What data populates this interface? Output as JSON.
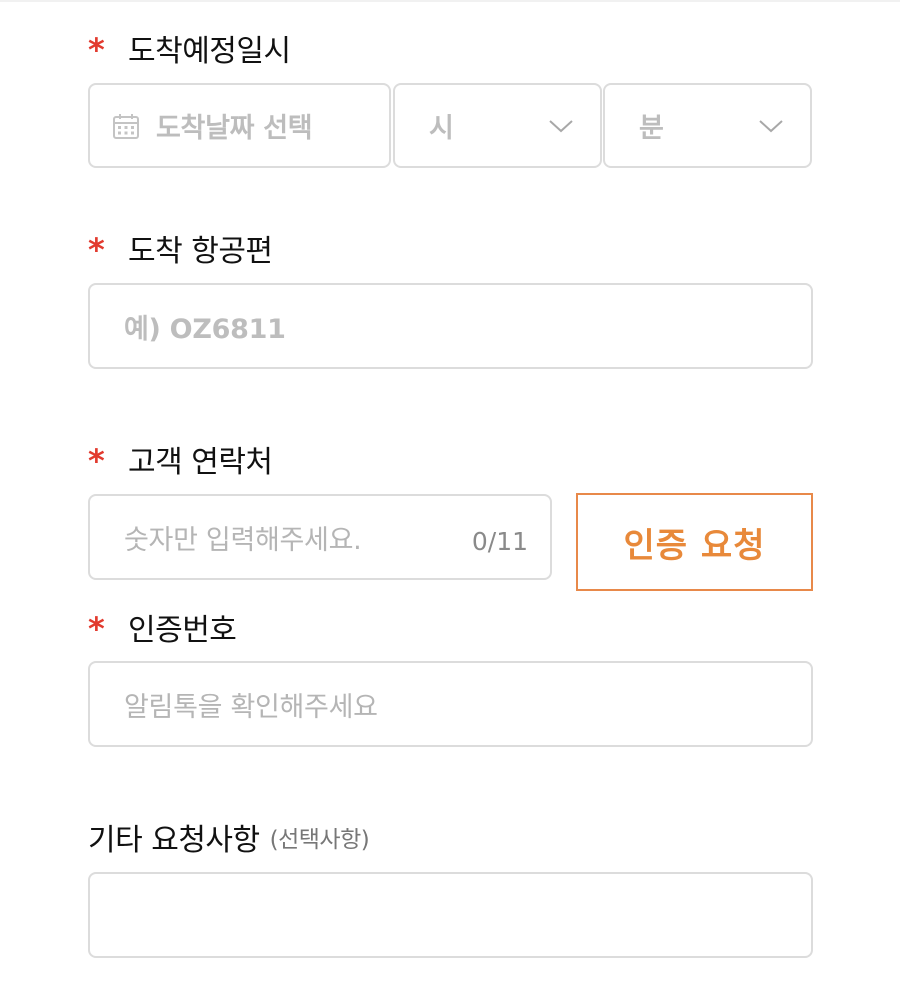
{
  "required_mark": "*",
  "arrival_datetime": {
    "label": "도착예정일시",
    "date_placeholder": "도착날짜 선택",
    "hour_placeholder": "시",
    "minute_placeholder": "분"
  },
  "arrival_flight": {
    "label": "도착 항공편",
    "placeholder": "예) OZ6811"
  },
  "customer_contact": {
    "label": "고객 연락처",
    "placeholder": "숫자만 입력해주세요.",
    "char_count": "0/11",
    "auth_button": "인증 요청"
  },
  "auth_code": {
    "label": "인증번호",
    "placeholder": "알림톡을 확인해주세요"
  },
  "other_requests": {
    "label": "기타 요청사항",
    "optional_hint": "(선택사항)",
    "value": ""
  },
  "colors": {
    "required": "#e23a2e",
    "accent": "#e8893a",
    "border": "#dcdcdc",
    "placeholder": "#b5b5b5"
  },
  "icons": {
    "date": "calendar-icon",
    "select": "chevron-down-icon"
  }
}
